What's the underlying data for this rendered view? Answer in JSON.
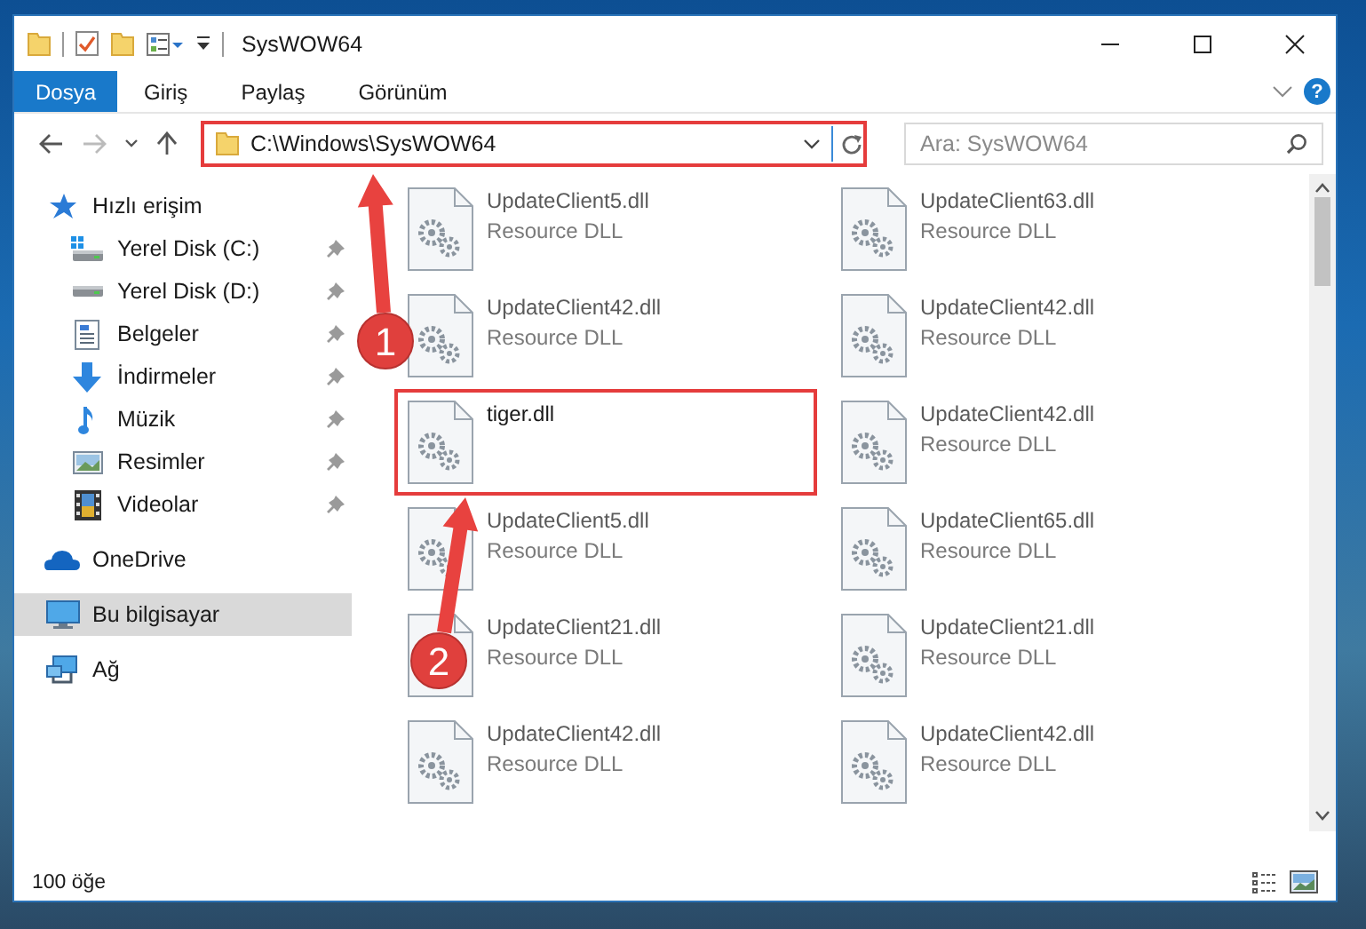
{
  "window": {
    "title": "SysWOW64"
  },
  "ribbon": {
    "tabs": [
      {
        "label": "Dosya",
        "selected": true
      },
      {
        "label": "Giriş",
        "selected": false
      },
      {
        "label": "Paylaş",
        "selected": false
      },
      {
        "label": "Görünüm",
        "selected": false
      }
    ],
    "help": "?"
  },
  "address": {
    "value": "C:\\Windows\\SysWOW64",
    "highlighted": true
  },
  "search": {
    "placeholder": "Ara: SysWOW64"
  },
  "sidebar": {
    "items": [
      {
        "label": "Hızlı erişim",
        "kind": "star",
        "selected": false,
        "children": [
          {
            "label": "Yerel Disk (C:)",
            "kind": "system-drive",
            "pinned": true,
            "selected": false
          },
          {
            "label": "Yerel Disk (D:)",
            "kind": "drive",
            "pinned": true,
            "selected": false
          },
          {
            "label": "Belgeler",
            "kind": "documents",
            "pinned": true,
            "selected": false
          },
          {
            "label": "İndirmeler",
            "kind": "downloads",
            "pinned": true,
            "selected": false
          },
          {
            "label": "Müzik",
            "kind": "music",
            "pinned": true,
            "selected": false
          },
          {
            "label": "Resimler",
            "kind": "pictures",
            "pinned": true,
            "selected": false
          },
          {
            "label": "Videolar",
            "kind": "videos",
            "pinned": true,
            "selected": false
          }
        ]
      },
      {
        "label": "OneDrive",
        "kind": "cloud",
        "selected": false
      },
      {
        "label": "Bu bilgisayar",
        "kind": "computer",
        "selected": true
      },
      {
        "label": "Ağ",
        "kind": "network",
        "selected": false
      }
    ]
  },
  "files": [
    {
      "name": "UpdateClient5.dll",
      "type": "Resource DLL",
      "blurred": true,
      "highlighted": false
    },
    {
      "name": "UpdateClient63.dll",
      "type": "Resource DLL",
      "blurred": true,
      "highlighted": false
    },
    {
      "name": "UpdateClient42.dll",
      "type": "Resource DLL",
      "blurred": true,
      "highlighted": false
    },
    {
      "name": "UpdateClient42.dll",
      "type": "Resource DLL",
      "blurred": true,
      "highlighted": false
    },
    {
      "name": "tiger.dll",
      "blurred": false,
      "highlighted": true
    },
    {
      "name": "UpdateClient42.dll",
      "type": "Resource DLL",
      "blurred": true,
      "highlighted": false
    },
    {
      "name": "UpdateClient5.dll",
      "type": "Resource DLL",
      "blurred": true,
      "highlighted": false
    },
    {
      "name": "UpdateClient65.dll",
      "type": "Resource DLL",
      "blurred": true,
      "highlighted": false
    },
    {
      "name": "UpdateClient21.dll",
      "type": "Resource DLL",
      "blurred": true,
      "highlighted": false
    },
    {
      "name": "UpdateClient21.dll",
      "type": "Resource DLL",
      "blurred": true,
      "highlighted": false
    },
    {
      "name": "UpdateClient42.dll",
      "type": "Resource DLL",
      "blurred": true,
      "highlighted": false
    },
    {
      "name": "UpdateClient42.dll",
      "type": "Resource DLL",
      "blurred": true,
      "highlighted": false
    }
  ],
  "status_bar": {
    "count": "100 öğe"
  },
  "callouts": [
    {
      "number": "1"
    },
    {
      "number": "2"
    }
  ]
}
